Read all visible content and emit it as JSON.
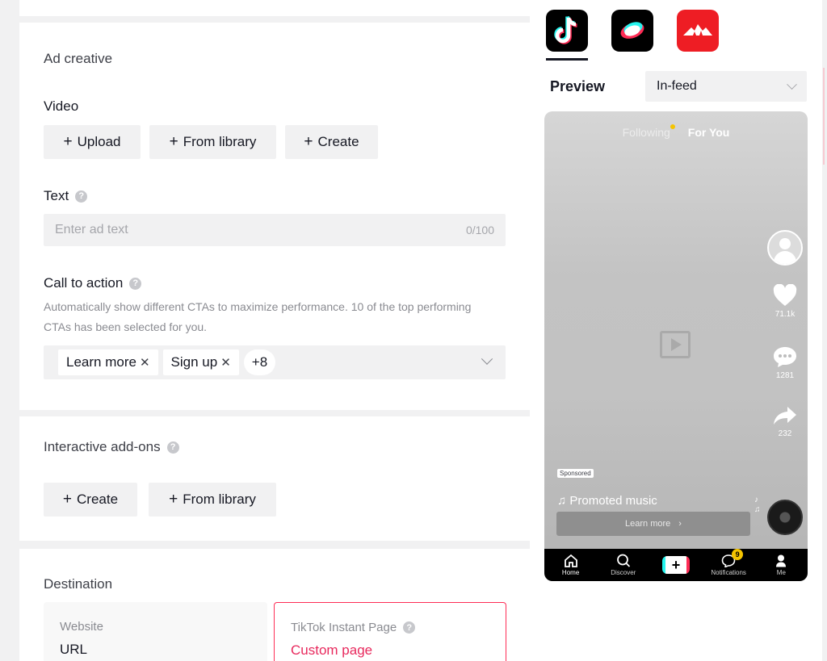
{
  "ad_creative": {
    "section_title": "Ad creative",
    "video": {
      "label": "Video",
      "upload_label": "Upload",
      "library_label": "From library",
      "create_label": "Create"
    },
    "text": {
      "label": "Text",
      "placeholder": "Enter ad text",
      "counter": "0/100"
    },
    "cta": {
      "label": "Call to action",
      "description": "Automatically show different CTAs to maximize performance. 10 of the top performing CTAs has been selected for you.",
      "chips": [
        "Learn more",
        "Sign up"
      ],
      "more": "+8"
    }
  },
  "interactive": {
    "section_title": "Interactive add-ons",
    "create_label": "Create",
    "library_label": "From library"
  },
  "destination": {
    "section_title": "Destination",
    "website": {
      "key": "Website",
      "value": "URL"
    },
    "instant_page": {
      "key": "TikTok Instant Page",
      "value": "Custom page"
    }
  },
  "preview": {
    "label": "Preview",
    "placement": "In-feed",
    "phone": {
      "tab_following": "Following",
      "tab_for_you": "For You",
      "likes": "71.1k",
      "comments": "1281",
      "shares": "232",
      "sponsored": "Sponsored",
      "music": "♫ Promoted music",
      "cta_button": "Learn more",
      "nav": {
        "home": "Home",
        "discover": "Discover",
        "notifications": "Notifications",
        "notifications_badge": "9",
        "me": "Me"
      }
    }
  },
  "colors": {
    "accent_pink": "#fe2c55",
    "custom_page_text": "#e8295d",
    "field_bg": "#f1f1f2"
  }
}
